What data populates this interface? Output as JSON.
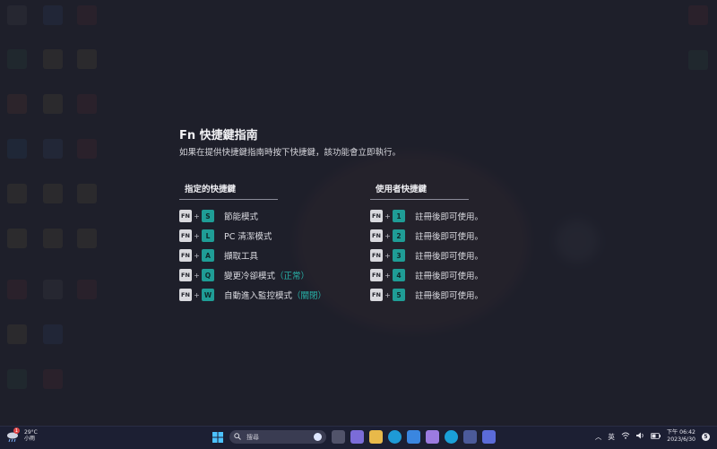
{
  "guide": {
    "title": "Fn 快捷鍵指南",
    "subtitle": "如果在提供快捷鍵指南時按下快捷鍵，該功能會立即執行。"
  },
  "assigned": {
    "header": "指定的快捷鍵",
    "fn_label": "FN",
    "plus": "+",
    "items": [
      {
        "key": "S",
        "label": "節能模式",
        "note": ""
      },
      {
        "key": "L",
        "label": "PC 清潔模式",
        "note": ""
      },
      {
        "key": "A",
        "label": "擷取工具",
        "note": ""
      },
      {
        "key": "Q",
        "label": "變更冷卻模式",
        "note": "（正常）"
      },
      {
        "key": "W",
        "label": "自動進入監控模式",
        "note": "（關閉）"
      }
    ]
  },
  "user": {
    "header": "使用者快捷鍵",
    "fn_label": "FN",
    "plus": "+",
    "items": [
      {
        "key": "1",
        "label": "註冊後即可使用。"
      },
      {
        "key": "2",
        "label": "註冊後即可使用。"
      },
      {
        "key": "3",
        "label": "註冊後即可使用。"
      },
      {
        "key": "4",
        "label": "註冊後即可使用。"
      },
      {
        "key": "5",
        "label": "註冊後即可使用。"
      }
    ]
  },
  "taskbar": {
    "weather_temp": "29°C",
    "weather_desc": "小雨",
    "weather_badge": "1",
    "search_placeholder": "搜尋",
    "ime": "英",
    "time": "下午 06:42",
    "date": "2023/6/30",
    "notification_count": "5"
  },
  "colors": {
    "accent": "#1f9d96",
    "accent_text": "#28b3a9",
    "background": "#20212b",
    "taskbar": "#1c1f33"
  }
}
